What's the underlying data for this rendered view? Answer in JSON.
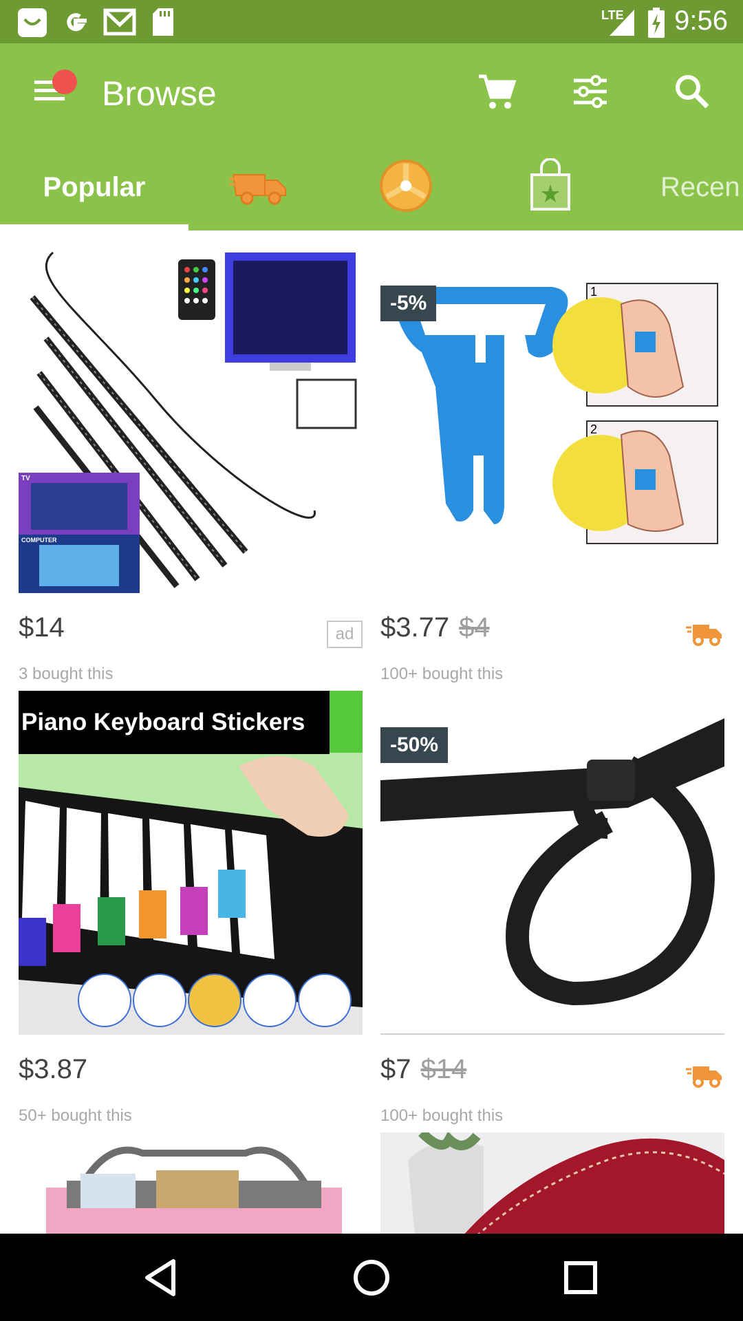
{
  "status_bar": {
    "time": "9:56",
    "network": "LTE",
    "icons": [
      "app-notification-icon",
      "google-icon",
      "gmail-icon",
      "sd-card-icon",
      "signal-icon",
      "battery-charging-icon"
    ]
  },
  "toolbar": {
    "title": "Browse",
    "icons": [
      "menu-icon",
      "cart-icon",
      "filter-icon",
      "search-icon"
    ]
  },
  "tabs": [
    {
      "label": "Popular",
      "icon": null,
      "selected": true
    },
    {
      "label": "",
      "icon": "fast-delivery-truck-icon",
      "selected": false
    },
    {
      "label": "",
      "icon": "wheel-icon",
      "selected": false
    },
    {
      "label": "",
      "icon": "shopping-bag-star-icon",
      "selected": false
    },
    {
      "label": "Recen",
      "icon": null,
      "selected": false
    }
  ],
  "products": [
    {
      "image": "led-light-strips-tv",
      "price": "$14",
      "original_price": "",
      "discount": "",
      "bought": "3 bought this",
      "ad": "ad",
      "fast_shipping": false,
      "image_text": {
        "tv": "TV",
        "computer": "COMPUTER"
      }
    },
    {
      "image": "balloon-tying-tool",
      "price": "$3.77",
      "original_price": "$4",
      "discount": "-5%",
      "bought": "100+ bought this",
      "ad": "",
      "fast_shipping": true,
      "image_text": {
        "step1": "1",
        "step2": "2"
      }
    },
    {
      "image": "piano-keyboard-stickers",
      "price": "$3.87",
      "original_price": "",
      "discount": "",
      "bought": "50+ bought this",
      "ad": "",
      "fast_shipping": false,
      "image_text": {
        "banner": "Piano Keyboard Stickers"
      }
    },
    {
      "image": "black-cable-ties",
      "price": "$7",
      "original_price": "$14",
      "discount": "-50%",
      "bought": "100+ bought this",
      "ad": "",
      "fast_shipping": true,
      "image_text": {}
    },
    {
      "image": "pink-handbag-organizer",
      "price": "",
      "original_price": "",
      "discount": "",
      "bought": "",
      "ad": "",
      "fast_shipping": false,
      "image_text": {}
    },
    {
      "image": "red-leather-wallet",
      "price": "",
      "original_price": "",
      "discount": "",
      "bought": "",
      "ad": "",
      "fast_shipping": false,
      "image_text": {}
    }
  ],
  "nav_bar": {
    "icons": [
      "back-icon",
      "home-icon",
      "recents-icon"
    ]
  },
  "colors": {
    "status_bar": "#6e9a33",
    "toolbar": "#8bc34a",
    "discount_badge": "#37474f",
    "delivery": "#f0953a",
    "notification_dot": "#ef5350"
  }
}
